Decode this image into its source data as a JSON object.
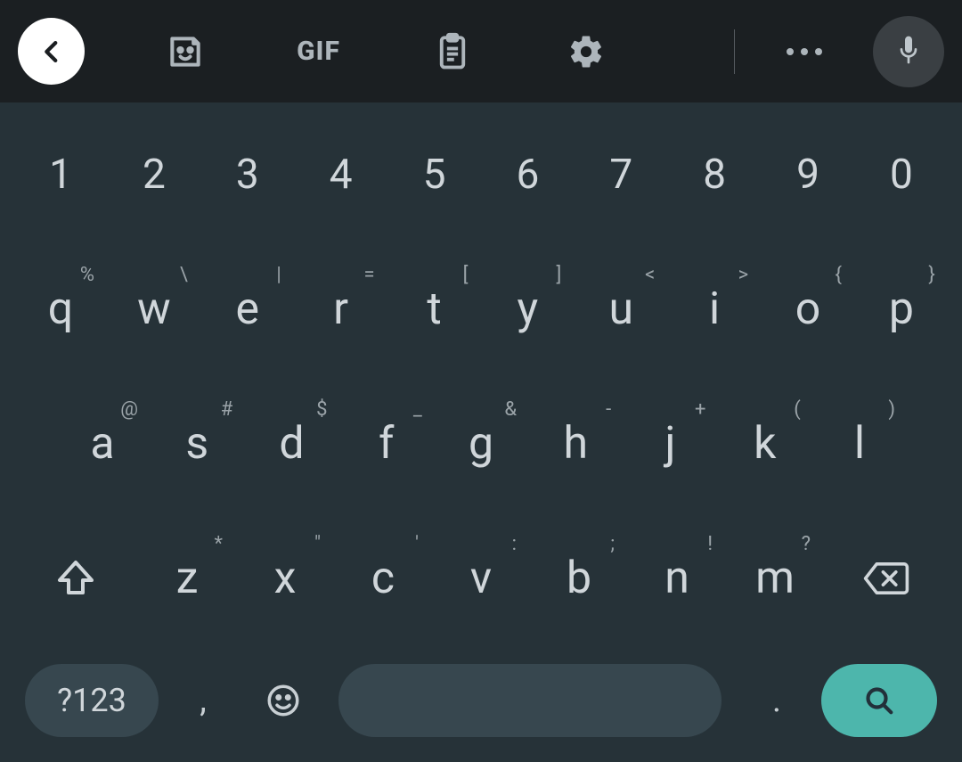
{
  "toolbar": {
    "gif_label": "GIF"
  },
  "rows": {
    "numbers": [
      "1",
      "2",
      "3",
      "4",
      "5",
      "6",
      "7",
      "8",
      "9",
      "0"
    ],
    "top": [
      {
        "k": "q",
        "h": "%"
      },
      {
        "k": "w",
        "h": "\\"
      },
      {
        "k": "e",
        "h": "|"
      },
      {
        "k": "r",
        "h": "="
      },
      {
        "k": "t",
        "h": "["
      },
      {
        "k": "y",
        "h": "]"
      },
      {
        "k": "u",
        "h": "<"
      },
      {
        "k": "i",
        "h": ">"
      },
      {
        "k": "o",
        "h": "{"
      },
      {
        "k": "p",
        "h": "}"
      }
    ],
    "mid": [
      {
        "k": "a",
        "h": "@"
      },
      {
        "k": "s",
        "h": "#"
      },
      {
        "k": "d",
        "h": "$"
      },
      {
        "k": "f",
        "h": "_"
      },
      {
        "k": "g",
        "h": "&"
      },
      {
        "k": "h",
        "h": "-"
      },
      {
        "k": "j",
        "h": "+"
      },
      {
        "k": "k",
        "h": "("
      },
      {
        "k": "l",
        "h": ")"
      }
    ],
    "bot": [
      {
        "k": "z",
        "h": "*"
      },
      {
        "k": "x",
        "h": "\""
      },
      {
        "k": "c",
        "h": "'"
      },
      {
        "k": "v",
        "h": ":"
      },
      {
        "k": "b",
        "h": ";"
      },
      {
        "k": "n",
        "h": "!"
      },
      {
        "k": "m",
        "h": "?"
      }
    ]
  },
  "bottom": {
    "symnum_label": "?123",
    "comma": ",",
    "period": "."
  }
}
